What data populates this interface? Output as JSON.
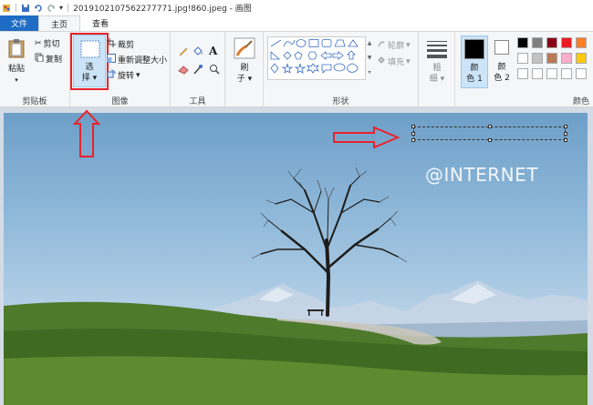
{
  "window": {
    "title": "2019102107562277771.jpg!860.jpeg - 画图"
  },
  "tabs": [
    {
      "label": "文件"
    },
    {
      "label": "主页"
    },
    {
      "label": "查看"
    }
  ],
  "clipboard": {
    "paste": "粘贴",
    "cut": "剪切",
    "copy": "复制",
    "group": "剪贴板"
  },
  "image": {
    "select_line1": "选",
    "select_line2": "择",
    "crop": "裁剪",
    "resize": "重新调整大小",
    "rotate": "旋转",
    "group": "图像"
  },
  "tools": {
    "group": "工具",
    "text_icon": "A"
  },
  "brushes": {
    "line1": "刷",
    "line2": "子"
  },
  "shapes": {
    "outline": "轮廓",
    "fill": "填充",
    "group": "形状"
  },
  "size": {
    "line1": "粗",
    "line2": "细"
  },
  "colors": {
    "color1_line1": "颜",
    "color1_line2": "色 1",
    "color2_line1": "颜",
    "color2_line2": "色 2",
    "group": "颜色",
    "palette": [
      "#000000",
      "#7f7f7f",
      "#880015",
      "#ed1c24",
      "#ff7f27",
      "#ffffff",
      "#c3c3c3",
      "#b97a57",
      "#ffaec9",
      "#ffc90e",
      "#ffffff",
      "#ffffff",
      "#ffffff",
      "#ffffff",
      "#ffffff"
    ]
  },
  "canvas": {
    "watermark": "@INTERNET"
  },
  "accent": "#e8232b"
}
